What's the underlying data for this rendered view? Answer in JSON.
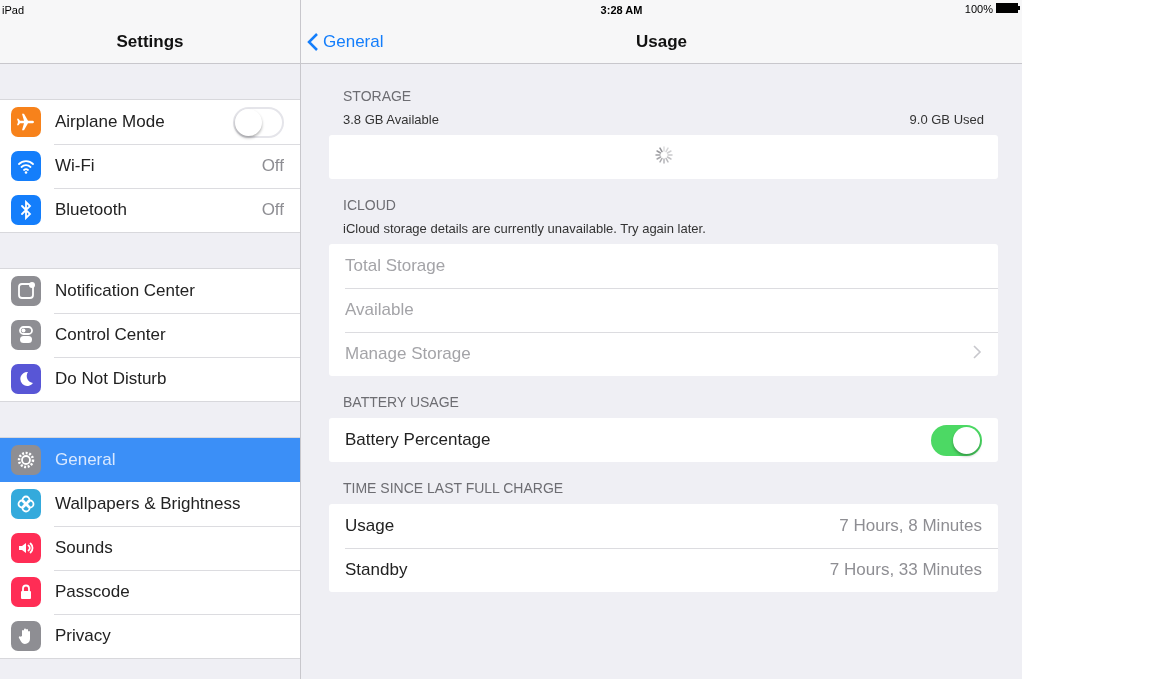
{
  "status_bar": {
    "device": "iPad",
    "time": "3:28 AM",
    "battery": "100%"
  },
  "sidebar": {
    "title": "Settings",
    "groups": [
      {
        "items": [
          {
            "label": "Airplane Mode",
            "color": "#f7821b",
            "kind": "toggle",
            "on": false,
            "selected": false
          },
          {
            "label": "Wi-Fi",
            "color": "#147efb",
            "kind": "value",
            "value": "Off",
            "selected": false
          },
          {
            "label": "Bluetooth",
            "color": "#147efb",
            "kind": "value",
            "value": "Off",
            "selected": false
          }
        ]
      },
      {
        "items": [
          {
            "label": "Notification Center",
            "color": "#8e8e93",
            "kind": "plain",
            "selected": false
          },
          {
            "label": "Control Center",
            "color": "#8e8e93",
            "kind": "plain",
            "selected": false
          },
          {
            "label": "Do Not Disturb",
            "color": "#5856d6",
            "kind": "plain",
            "selected": false
          }
        ]
      },
      {
        "items": [
          {
            "label": "General",
            "color": "#8e8e93",
            "kind": "plain",
            "selected": true
          },
          {
            "label": "Wallpapers & Brightness",
            "color": "#34aadc",
            "kind": "plain",
            "selected": false
          },
          {
            "label": "Sounds",
            "color": "#ff2d55",
            "kind": "plain",
            "selected": false
          },
          {
            "label": "Passcode",
            "color": "#ff2d55",
            "kind": "plain",
            "selected": false
          },
          {
            "label": "Privacy",
            "color": "#8e8e93",
            "kind": "plain",
            "selected": false
          }
        ]
      }
    ]
  },
  "main": {
    "back": "General",
    "title": "Usage",
    "sections": [
      {
        "header": "STORAGE",
        "summary": {
          "available": "3.8 GB Available",
          "used": "9.0 GB Used"
        },
        "loading": true
      },
      {
        "header": "ICLOUD",
        "note": "iCloud storage details are currently unavailable. Try again later.",
        "rows": [
          {
            "label": "Total Storage",
            "kind": "plain",
            "disabled": true
          },
          {
            "label": "Available",
            "kind": "plain",
            "disabled": true
          },
          {
            "label": "Manage Storage",
            "kind": "link",
            "disabled": true
          }
        ]
      },
      {
        "header": "BATTERY USAGE",
        "rows": [
          {
            "label": "Battery Percentage",
            "kind": "toggle",
            "on": true,
            "disabled": false
          }
        ]
      },
      {
        "header": "TIME SINCE LAST FULL CHARGE",
        "rows": [
          {
            "label": "Usage",
            "kind": "value",
            "value": "7 Hours, 8 Minutes",
            "disabled": false
          },
          {
            "label": "Standby",
            "kind": "value",
            "value": "7 Hours, 33 Minutes",
            "disabled": false
          }
        ]
      }
    ]
  }
}
